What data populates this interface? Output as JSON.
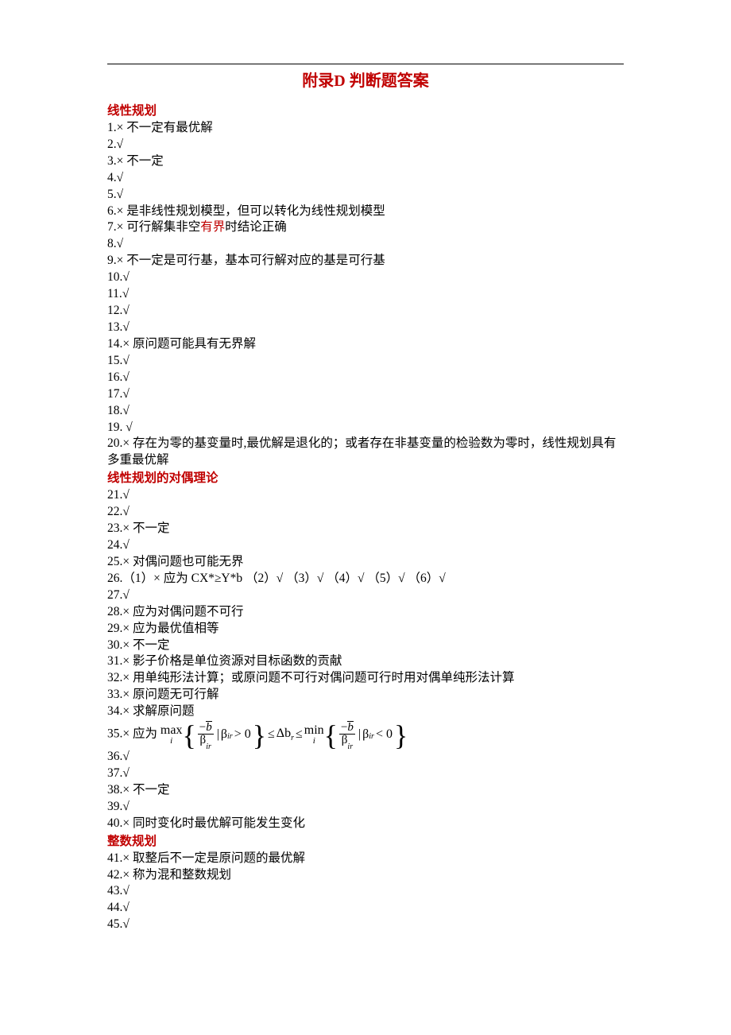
{
  "title_pre": "附录",
  "title_latin": "D",
  "title_post": " 判断题答案",
  "sections": [
    {
      "heading": "线性规划",
      "items": [
        {
          "n": "1.",
          "mark": "×",
          "text": " 不一定有最优解"
        },
        {
          "n": "2.",
          "mark": "√",
          "text": ""
        },
        {
          "n": "3.",
          "mark": "×",
          "text": "   不一定"
        },
        {
          "n": "4.",
          "mark": "√",
          "text": ""
        },
        {
          "n": "5.",
          "mark": "√",
          "text": ""
        },
        {
          "n": "6.",
          "mark": "×",
          "text": " 是非线性规划模型，但可以转化为线性规划模型"
        },
        {
          "n": "7.",
          "mark": "×",
          "text_pre": " 可行解集非空",
          "red": "有界",
          "text_post": "时结论正确"
        },
        {
          "n": "8.",
          "mark": "√",
          "text": ""
        },
        {
          "n": "9.",
          "mark": "×",
          "text": "   不一定是可行基，基本可行解对应的基是可行基"
        },
        {
          "n": "10.",
          "mark": "√",
          "text": ""
        },
        {
          "n": "11.",
          "mark": "√",
          "text": ""
        },
        {
          "n": "12.",
          "mark": "√",
          "text": ""
        },
        {
          "n": "13.",
          "mark": "√",
          "text": ""
        },
        {
          "n": "14.",
          "mark": "×",
          "text": "   原问题可能具有无界解"
        },
        {
          "n": "15.",
          "mark": "√",
          "text": ""
        },
        {
          "n": "16.",
          "mark": "√",
          "text": ""
        },
        {
          "n": "17.",
          "mark": "√",
          "text": ""
        },
        {
          "n": "18.",
          "mark": "√",
          "text": ""
        },
        {
          "n": "19. ",
          "mark": "√",
          "text": ""
        },
        {
          "n": "20.",
          "mark": "×",
          "text": " 存在为零的基变量时,最优解是退化的；或者存在非基变量的检验数为零时，线性规划具有多重最优解"
        }
      ]
    },
    {
      "heading": "线性规划的对偶理论",
      "items": [
        {
          "n": "21.",
          "mark": "√",
          "text": ""
        },
        {
          "n": "22.",
          "mark": "√",
          "text": ""
        },
        {
          "n": "23.",
          "mark": "×",
          "text": " 不一定"
        },
        {
          "n": "24.",
          "mark": "√",
          "text": ""
        },
        {
          "n": "25.",
          "mark": "×",
          "text": " 对偶问题也可能无界"
        },
        {
          "n": "26.",
          "mark": "",
          "text": "（1）× 应为 CX*≥Y*b   （2）√   （3）√   （4）√   （5）√   （6）√"
        },
        {
          "n": "27.",
          "mark": "√",
          "text": ""
        },
        {
          "n": "28.",
          "mark": "×",
          "text": " 应为对偶问题不可行"
        },
        {
          "n": "29.",
          "mark": "×",
          "text": " 应为最优值相等"
        },
        {
          "n": "30.",
          "mark": "×",
          "text": " 不一定"
        },
        {
          "n": "31.",
          "mark": "×",
          "text": " 影子价格是单位资源对目标函数的贡献"
        },
        {
          "n": "32.",
          "mark": "×",
          "text": " 用单纯形法计算；或原问题不可行对偶问题可行时用对偶单纯形法计算"
        },
        {
          "n": "33.",
          "mark": "×",
          "text": " 原问题无可行解"
        },
        {
          "n": "34.",
          "mark": "×",
          "text": " 求解原问题"
        },
        {
          "n": "35.",
          "mark": "×",
          "text": " 应为   ",
          "formula": true
        },
        {
          "n": "36.",
          "mark": "√",
          "text": ""
        },
        {
          "n": "37.",
          "mark": "√",
          "text": ""
        },
        {
          "n": "38.",
          "mark": "×",
          "text": " 不一定"
        },
        {
          "n": "39.",
          "mark": "√",
          "text": ""
        },
        {
          "n": "40.",
          "mark": "×",
          "text": " 同时变化时最优解可能发生变化"
        }
      ]
    },
    {
      "heading": "整数规划",
      "items": [
        {
          "n": "41.",
          "mark": "×",
          "text": " 取整后不一定是原问题的最优解"
        },
        {
          "n": "42.",
          "mark": "×",
          "text": " 称为混和整数规划"
        },
        {
          "n": "43.",
          "mark": "√",
          "text": ""
        },
        {
          "n": "44.",
          "mark": "√",
          "text": ""
        },
        {
          "n": "45.",
          "mark": "√",
          "text": ""
        }
      ]
    }
  ],
  "formula": {
    "max": "max",
    "min": "min",
    "sub": "i",
    "b": "b",
    "beta": "β",
    "ir": "ir",
    "gt": "> 0",
    "lt": "< 0",
    "le": "≤",
    "delta": "Δb",
    "r": "r",
    "pipe": "|"
  }
}
